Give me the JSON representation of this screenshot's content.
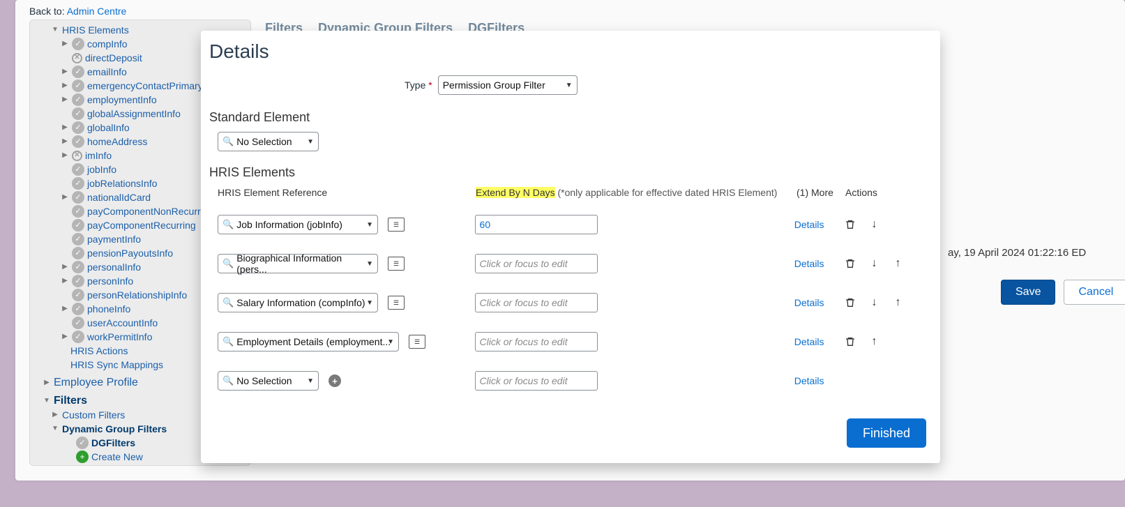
{
  "back_to_prefix": "Back to: ",
  "back_to_link": "Admin Centre",
  "tree": {
    "root_label": "HRIS Elements",
    "items": [
      {
        "label": "compInfo",
        "ico": "check",
        "exp": "right"
      },
      {
        "label": "directDeposit",
        "ico": "cross",
        "exp": ""
      },
      {
        "label": "emailInfo",
        "ico": "check",
        "exp": "right"
      },
      {
        "label": "emergencyContactPrimary",
        "ico": "check",
        "exp": "right"
      },
      {
        "label": "employmentInfo",
        "ico": "check",
        "exp": "right"
      },
      {
        "label": "globalAssignmentInfo",
        "ico": "check",
        "exp": ""
      },
      {
        "label": "globalInfo",
        "ico": "check",
        "exp": "right"
      },
      {
        "label": "homeAddress",
        "ico": "check",
        "exp": "right"
      },
      {
        "label": "imInfo",
        "ico": "cross",
        "exp": "right"
      },
      {
        "label": "jobInfo",
        "ico": "check",
        "exp": ""
      },
      {
        "label": "jobRelationsInfo",
        "ico": "check",
        "exp": ""
      },
      {
        "label": "nationalIdCard",
        "ico": "check",
        "exp": "right"
      },
      {
        "label": "payComponentNonRecurring",
        "ico": "check",
        "exp": ""
      },
      {
        "label": "payComponentRecurring",
        "ico": "check",
        "exp": ""
      },
      {
        "label": "paymentInfo",
        "ico": "check",
        "exp": ""
      },
      {
        "label": "pensionPayoutsInfo",
        "ico": "check",
        "exp": ""
      },
      {
        "label": "personalInfo",
        "ico": "check",
        "exp": "right"
      },
      {
        "label": "personInfo",
        "ico": "check",
        "exp": "right"
      },
      {
        "label": "personRelationshipInfo",
        "ico": "check",
        "exp": ""
      },
      {
        "label": "phoneInfo",
        "ico": "check",
        "exp": "right"
      },
      {
        "label": "userAccountInfo",
        "ico": "check",
        "exp": ""
      },
      {
        "label": "workPermitInfo",
        "ico": "check",
        "exp": "right"
      }
    ],
    "siblings": [
      {
        "label": "HRIS Actions",
        "indent": 1
      },
      {
        "label": "HRIS Sync Mappings",
        "indent": 1
      }
    ],
    "l1": [
      {
        "label": "Employee Profile",
        "exp": "right"
      },
      {
        "label": "Filters",
        "exp": "down",
        "bold": true
      }
    ],
    "filters_children": [
      {
        "label": "Custom Filters",
        "exp": "right",
        "ico": ""
      },
      {
        "label": "Dynamic Group Filters",
        "exp": "down",
        "ico": "",
        "bold": true
      }
    ],
    "dg_children": [
      {
        "label": "DGFilters",
        "ico": "check",
        "bold": true
      },
      {
        "label": "Create New",
        "ico": "add"
      }
    ]
  },
  "tabs": [
    "Filters",
    "Dynamic Group Filters",
    "DGFilters"
  ],
  "timestamp_suffix": "ay, 19 April 2024 01:22:16 ED",
  "save_label": "Save",
  "cancel_label": "Cancel",
  "modal": {
    "title": "Details",
    "type_label": "Type",
    "type_value": "Permission Group Filter",
    "section_std": "Standard Element",
    "std_value": "No Selection",
    "section_hris": "HRIS Elements",
    "head_ref": "HRIS Element Reference",
    "head_extend": "Extend By N Days",
    "head_extend_note": " (*only applicable for effective dated HRIS Element)",
    "head_more": "(1) More",
    "head_actions": "Actions",
    "rows": [
      {
        "ref": "Job Information (jobInfo)",
        "extend": "60",
        "placeholder": "",
        "mini": true,
        "details": "Details",
        "trash": true,
        "down": true,
        "up": false
      },
      {
        "ref": "Biographical Information (pers...",
        "extend": "",
        "placeholder": "Click or focus to edit",
        "mini": true,
        "details": "Details",
        "trash": true,
        "down": true,
        "up": true
      },
      {
        "ref": "Salary Information (compInfo)",
        "extend": "",
        "placeholder": "Click or focus to edit",
        "mini": true,
        "details": "Details",
        "trash": true,
        "down": true,
        "up": true
      },
      {
        "ref": "Employment Details (employment...",
        "extend": "",
        "placeholder": "Click or focus to edit",
        "mini": true,
        "details": "Details",
        "trash": true,
        "down": false,
        "up": true
      },
      {
        "ref": "No Selection",
        "extend": "",
        "placeholder": "Click or focus to edit",
        "mini": false,
        "add": true,
        "details": "Details",
        "trash": false,
        "down": false,
        "up": false
      }
    ],
    "finished": "Finished"
  }
}
